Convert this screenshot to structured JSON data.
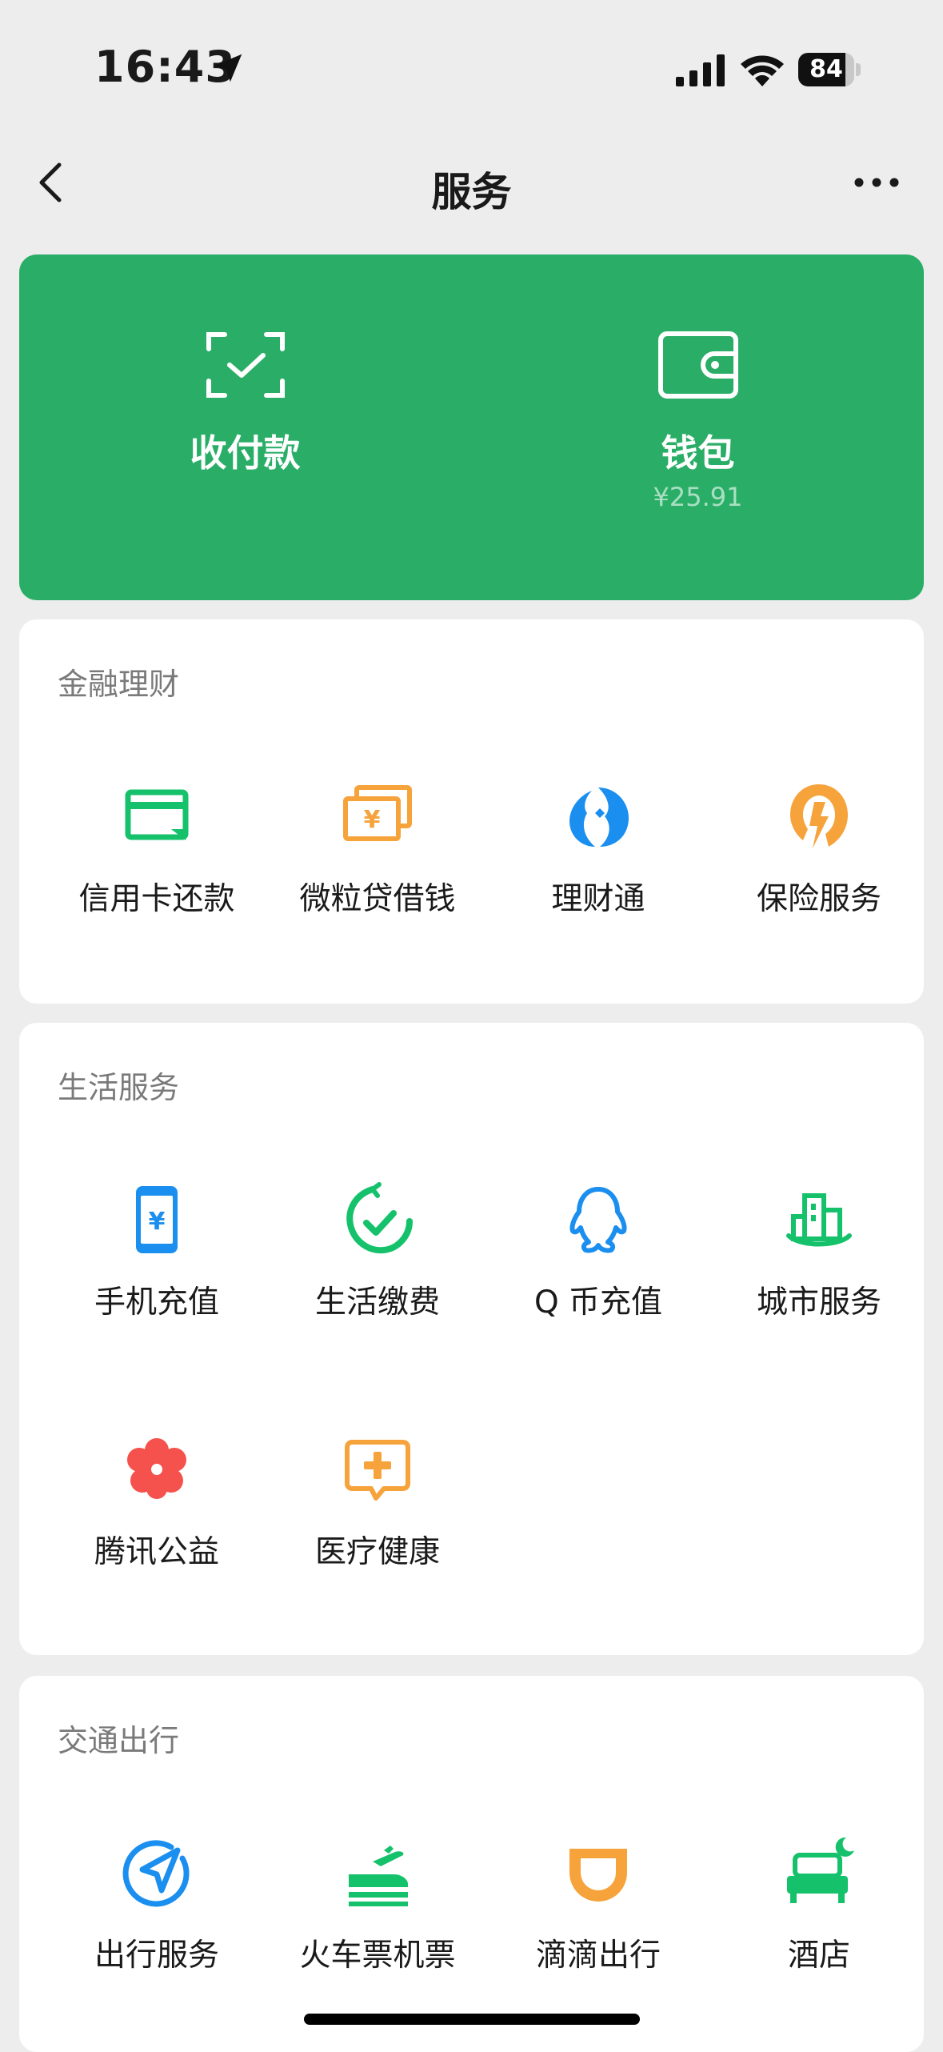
{
  "status_bar": {
    "time": "16:43",
    "battery": "84",
    "battery_level": 0.84
  },
  "nav": {
    "title": "服务"
  },
  "pay_card": {
    "items": [
      {
        "label": "收付款",
        "icon": "scan-pay-icon"
      },
      {
        "label": "钱包",
        "sub": "¥25.91",
        "icon": "wallet-icon"
      }
    ]
  },
  "sections": [
    {
      "title": "金融理财",
      "items": [
        {
          "label": "信用卡还款",
          "icon": "credit-card-icon"
        },
        {
          "label": "微粒贷借钱",
          "icon": "loan-icon"
        },
        {
          "label": "理财通",
          "icon": "wealth-icon"
        },
        {
          "label": "保险服务",
          "icon": "insurance-icon"
        }
      ]
    },
    {
      "title": "生活服务",
      "items": [
        {
          "label": "手机充值",
          "icon": "phone-topup-icon"
        },
        {
          "label": "生活缴费",
          "icon": "bill-pay-icon"
        },
        {
          "label": "Q 币充值",
          "icon": "qq-coin-icon"
        },
        {
          "label": "城市服务",
          "icon": "city-service-icon"
        },
        {
          "label": "腾讯公益",
          "icon": "charity-icon"
        },
        {
          "label": "医疗健康",
          "icon": "medical-icon"
        }
      ]
    },
    {
      "title": "交通出行",
      "items": [
        {
          "label": "出行服务",
          "icon": "travel-icon"
        },
        {
          "label": "火车票机票",
          "icon": "train-plane-icon"
        },
        {
          "label": "滴滴出行",
          "icon": "didi-icon"
        },
        {
          "label": "酒店",
          "icon": "hotel-icon"
        }
      ]
    }
  ],
  "colors": {
    "green": "#2AAE67",
    "icon_green": "#15C26B",
    "icon_orange": "#F6A33C",
    "icon_blue": "#1B8FEF",
    "icon_red": "#F5514D"
  }
}
